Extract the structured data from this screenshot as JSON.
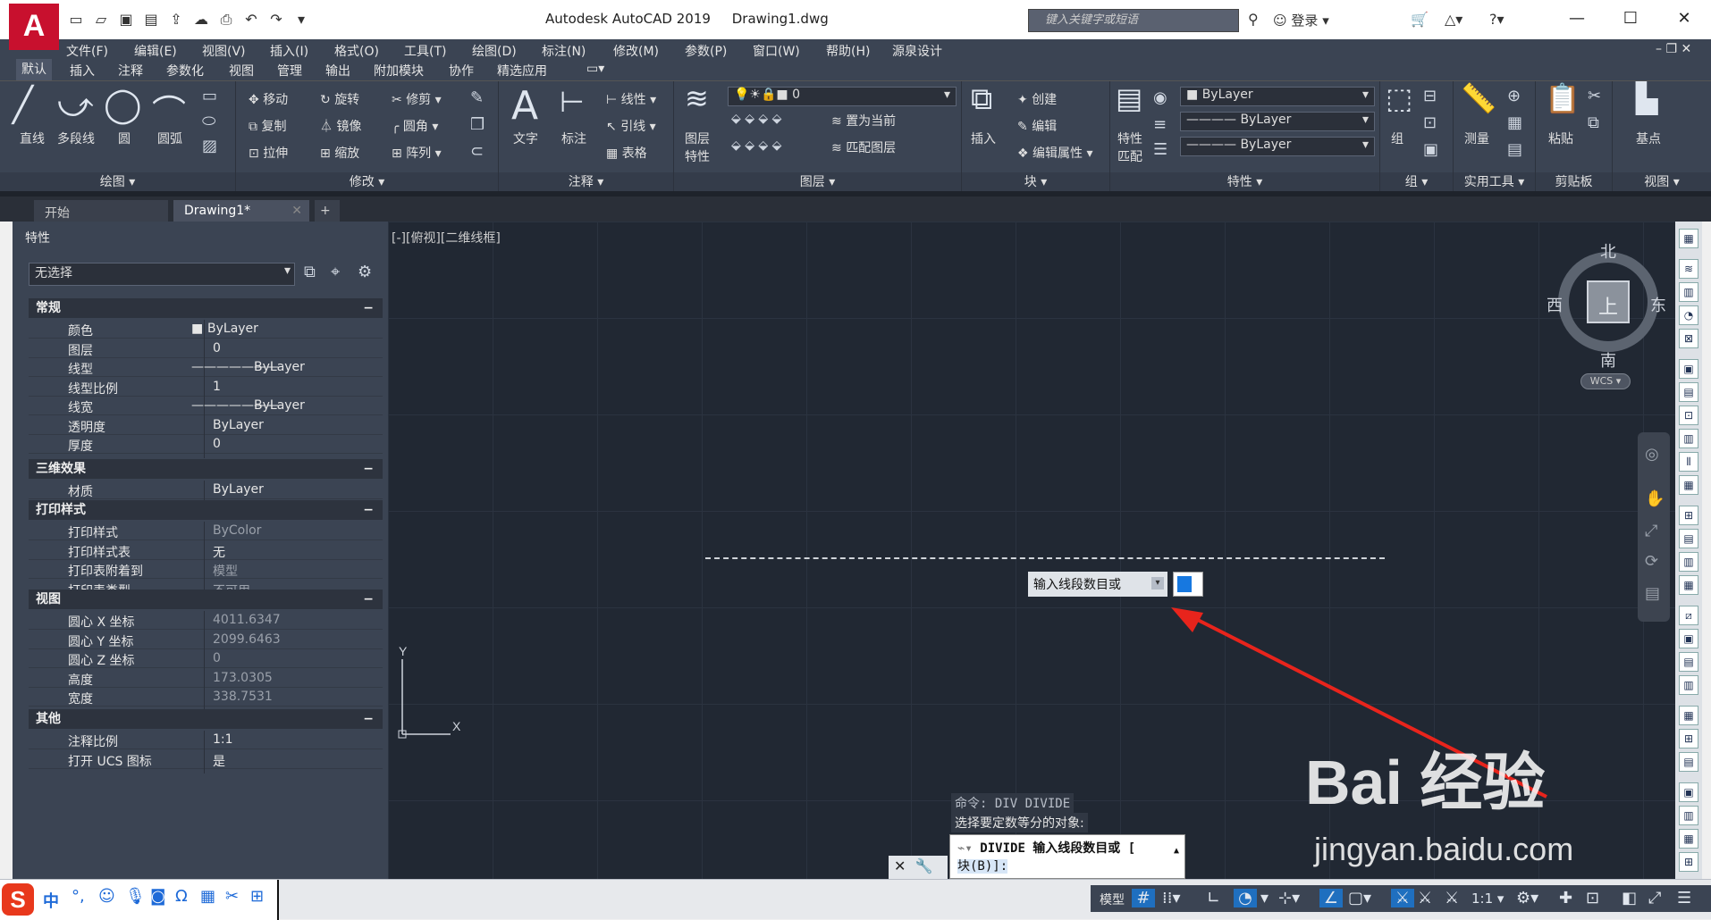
{
  "title_bar": {
    "app_name": "Autodesk AutoCAD 2019",
    "file_name": "Drawing1.dwg",
    "search_placeholder": "键入关键字或短语",
    "login_label": "登录"
  },
  "menu": [
    "文件(F)",
    "编辑(E)",
    "视图(V)",
    "插入(I)",
    "格式(O)",
    "工具(T)",
    "绘图(D)",
    "标注(N)",
    "修改(M)",
    "参数(P)",
    "窗口(W)",
    "帮助(H)",
    "源泉设计"
  ],
  "ribbon_tabs": [
    "默认",
    "插入",
    "注释",
    "参数化",
    "视图",
    "管理",
    "输出",
    "附加模块",
    "协作",
    "精选应用"
  ],
  "ribbon": {
    "draw": {
      "title": "绘图",
      "line": "直线",
      "polyline": "多段线",
      "circle": "圆",
      "arc": "圆弧"
    },
    "modify": {
      "title": "修改",
      "move": "移动",
      "rotate": "旋转",
      "trim": "修剪",
      "copy": "复制",
      "mirror": "镜像",
      "fillet": "圆角",
      "stretch": "拉伸",
      "scale": "缩放",
      "array": "阵列"
    },
    "annotation": {
      "title": "注释",
      "text": "文字",
      "dimension": "标注",
      "linear": "线性",
      "leader": "引线",
      "table": "表格"
    },
    "layers": {
      "title": "图层",
      "layer_props_1": "图层",
      "layer_props_2": "特性",
      "current_layer": "0",
      "set_current": "置为当前",
      "match_layer": "匹配图层"
    },
    "block": {
      "title": "块",
      "insert": "插入",
      "create": "创建",
      "edit": "编辑",
      "edit_attr": "编辑属性"
    },
    "properties": {
      "title": "特性",
      "match_1": "特性",
      "match_2": "匹配",
      "color": "ByLayer",
      "linetype": "ByLayer",
      "lineweight": "ByLayer"
    },
    "groups": {
      "title": "组",
      "group": "组"
    },
    "utilities": {
      "title": "实用工具",
      "measure": "测量"
    },
    "clipboard": {
      "title": "剪贴板",
      "paste": "粘贴"
    },
    "view": {
      "title": "视图",
      "base": "基点"
    }
  },
  "doc_tabs": {
    "start": "开始",
    "drawing": "Drawing1*"
  },
  "properties_panel": {
    "title": "特性",
    "selection": "无选择",
    "sections": [
      {
        "name": "常规",
        "rows": [
          {
            "name": "颜色",
            "value": "ByLayer"
          },
          {
            "name": "图层",
            "value": "0"
          },
          {
            "name": "线型",
            "value": "ByLayer"
          },
          {
            "name": "线型比例",
            "value": "1"
          },
          {
            "name": "线宽",
            "value": "ByLayer"
          },
          {
            "name": "透明度",
            "value": "ByLayer"
          },
          {
            "name": "厚度",
            "value": "0"
          }
        ]
      },
      {
        "name": "三维效果",
        "rows": [
          {
            "name": "材质",
            "value": "ByLayer"
          }
        ]
      },
      {
        "name": "打印样式",
        "rows": [
          {
            "name": "打印样式",
            "value": "ByColor"
          },
          {
            "name": "打印样式表",
            "value": "无"
          },
          {
            "name": "打印表附着到",
            "value": "模型"
          },
          {
            "name": "打印表类型",
            "value": "不可用"
          }
        ]
      },
      {
        "name": "视图",
        "rows": [
          {
            "name": "圆心 X 坐标",
            "value": "4011.6347"
          },
          {
            "name": "圆心 Y 坐标",
            "value": "2099.6463"
          },
          {
            "name": "圆心 Z 坐标",
            "value": "0"
          },
          {
            "name": "高度",
            "value": "173.0305"
          },
          {
            "name": "宽度",
            "value": "338.7531"
          }
        ]
      },
      {
        "name": "其他",
        "rows": [
          {
            "name": "注释比例",
            "value": "1:1"
          },
          {
            "name": "打开 UCS 图标",
            "value": "是"
          }
        ]
      }
    ]
  },
  "canvas": {
    "view_label": "[-][俯视][二维线框]",
    "tooltip": "输入线段数目或",
    "viewcube": {
      "north": "北",
      "south": "南",
      "east": "东",
      "west": "西",
      "top": "上",
      "wcs": "WCS"
    },
    "command_history_1": "命令: DIV DIVIDE",
    "command_history_2": "选择要定数等分的对象:",
    "command_line_1": "DIVIDE 输入线段数目或 [",
    "command_line_2": "块(B)]:"
  },
  "statusbar": {
    "ime_label": "中",
    "model": "模型",
    "scale": "1:1"
  },
  "watermark": {
    "brand": "Bai 经验",
    "url": "jingyan.baidu.com"
  },
  "colors": {
    "accent": "#1778e0",
    "ui_dark": "#3b4453",
    "canvas": "#212833",
    "arrow": "#e8241c"
  }
}
